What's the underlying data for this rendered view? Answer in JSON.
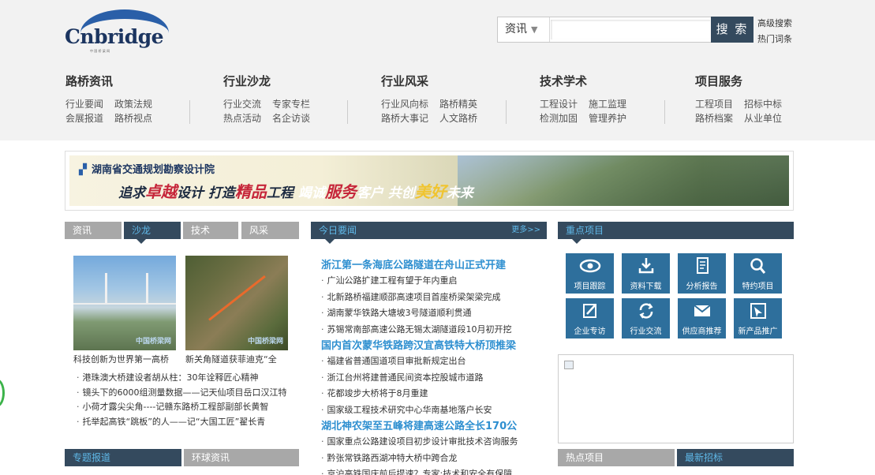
{
  "header": {
    "logo_text": "Cnbridge",
    "logo_sub": "中 国 桥 梁 网",
    "search": {
      "category": "资讯",
      "button": "搜 索",
      "placeholder": ""
    },
    "links": [
      "高级搜索",
      "热门词条"
    ]
  },
  "nav": [
    {
      "title": "路桥资讯",
      "row1": [
        "行业要闻",
        "政策法规"
      ],
      "row2": [
        "会展报道",
        "路桥视点"
      ]
    },
    {
      "title": "行业沙龙",
      "row1": [
        "行业交流",
        "专家专栏"
      ],
      "row2": [
        "热点活动",
        "名企访谈"
      ]
    },
    {
      "title": "行业风采",
      "row1": [
        "行业风向标",
        "路桥精英"
      ],
      "row2": [
        "路桥大事记",
        "人文路桥"
      ]
    },
    {
      "title": "技术学术",
      "row1": [
        "工程设计",
        "施工监理"
      ],
      "row2": [
        "检测加固",
        "管理养护"
      ]
    },
    {
      "title": "项目服务",
      "row1": [
        "工程项目",
        "招标中标"
      ],
      "row2": [
        "路桥档案",
        "从业单位"
      ]
    }
  ],
  "banner": {
    "org": "湖南省交通规划勘察设计院",
    "slogan_parts": [
      "追求",
      "卓越",
      "设计 ",
      "打造",
      "精品",
      "工程 ",
      "竭诚",
      "服务",
      "客户 ",
      "共创",
      "美好",
      "未来"
    ]
  },
  "left": {
    "tabs": [
      "资讯",
      "沙龙",
      "技术",
      "风采"
    ],
    "active_tab": "沙龙",
    "photos": [
      {
        "caption": "科技创新为世界第一高桥",
        "watermark": "中国桥梁网"
      },
      {
        "caption": "新关角隧道获菲迪克“全",
        "watermark": "中国桥梁网"
      }
    ],
    "list": [
      "港珠澳大桥建设者胡从柱：30年诠释匠心精神",
      "镜头下的6000组测量数据——记天仙项目岳口汉江特",
      "小荷才露尖尖角----记赣东路桥工程部副部长黄智",
      "托举起高铁“跳板”的人——记“大国工匠”翟长青"
    ],
    "bottom_tabs": [
      "专题报道",
      "环球资讯"
    ]
  },
  "middle": {
    "title": "今日要闻",
    "more": "更多>>",
    "blocks": [
      {
        "headline": "浙江第一条海底公路隧道在舟山正式开建",
        "items": [
          "广汕公路扩建工程有望于年内重启",
          "北新路桥福建顺邵高速项目首座桥梁架梁完成",
          "湖南蒙华铁路大塘坡3号隧道顺利贯通",
          "苏锡常南部高速公路无锡太湖隧道段10月初开挖"
        ]
      },
      {
        "headline": "国内首次蒙华铁路跨汉宜高铁特大桥顶推梁",
        "items": [
          "福建省普通国道项目审批新规定出台",
          "浙江台州将建普通民间资本控股城市道路",
          "花都竣步大桥将于8月重建",
          "国家级工程技术研究中心华南基地落户长安"
        ]
      },
      {
        "headline": "湖北神农架至五峰将建高速公路全长170公",
        "items": [
          "国家重点公路建设项目初步设计审批技术咨询服务",
          "黔张常铁路西湖冲特大桥中跨合龙",
          "京沪高铁国庆前后提速？专家:技术和安全有保障"
        ]
      }
    ]
  },
  "right": {
    "title": "重点项目",
    "tiles": [
      {
        "label": "项目跟踪",
        "icon": "eye-icon"
      },
      {
        "label": "资料下载",
        "icon": "download-icon"
      },
      {
        "label": "分析报告",
        "icon": "report-icon"
      },
      {
        "label": "特约项目",
        "icon": "magnifier-icon"
      },
      {
        "label": "企业专访",
        "icon": "edit-icon"
      },
      {
        "label": "行业交流",
        "icon": "refresh-icon"
      },
      {
        "label": "供应商推荐",
        "icon": "mail-icon"
      },
      {
        "label": "新产品推广",
        "icon": "cursor-icon"
      }
    ],
    "bottom_tabs": [
      "热点项目",
      "最新招标"
    ]
  },
  "colors": {
    "accent_dark": "#344a5e",
    "link_blue": "#2e8fd0",
    "tab_gray": "#a8a8a8",
    "tile_blue": "#2e6f9c"
  }
}
